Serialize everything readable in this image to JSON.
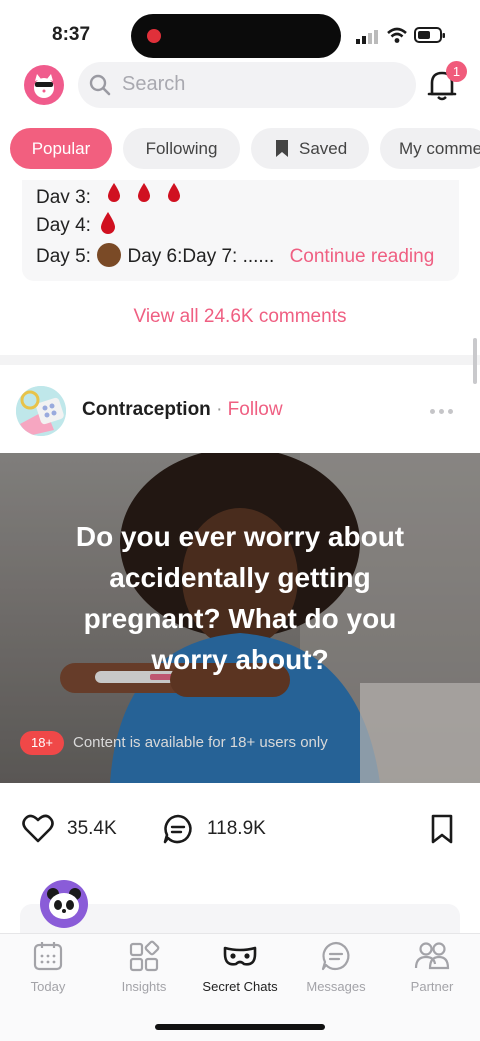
{
  "status_bar": {
    "time": "8:37"
  },
  "header": {
    "search_placeholder": "Search",
    "notification_count": "1"
  },
  "tabs": [
    {
      "label": "Popular",
      "active": true
    },
    {
      "label": "Following"
    },
    {
      "label": "Saved"
    },
    {
      "label": "My comme"
    }
  ],
  "previous_post": {
    "day3": "Day 3:",
    "day4": "Day 4:",
    "day5": "Day 5:",
    "day6": "Day 6:",
    "day7": "Day 7: ......",
    "continue_label": "Continue reading",
    "view_all_label": "View all 24.6K comments"
  },
  "post": {
    "author": "Contraception",
    "separator": "·",
    "follow_label": "Follow",
    "title": "Do you ever worry about accidentally getting pregnant? What do you worry about?",
    "age_badge": "18+",
    "age_text": "Content is available for 18+ users only",
    "likes": "35.4K",
    "comments": "118.9K"
  },
  "tab_bar": {
    "items": [
      {
        "label": "Today",
        "icon": "calendar-icon"
      },
      {
        "label": "Insights",
        "icon": "grid-icon"
      },
      {
        "label": "Secret Chats",
        "icon": "mask-icon",
        "active": true
      },
      {
        "label": "Messages",
        "icon": "chat-icon"
      },
      {
        "label": "Partner",
        "icon": "partner-icon"
      }
    ]
  },
  "colors": {
    "accent": "#f25f7f",
    "blood": "#d01020",
    "hero_bg": "#8b8784"
  }
}
